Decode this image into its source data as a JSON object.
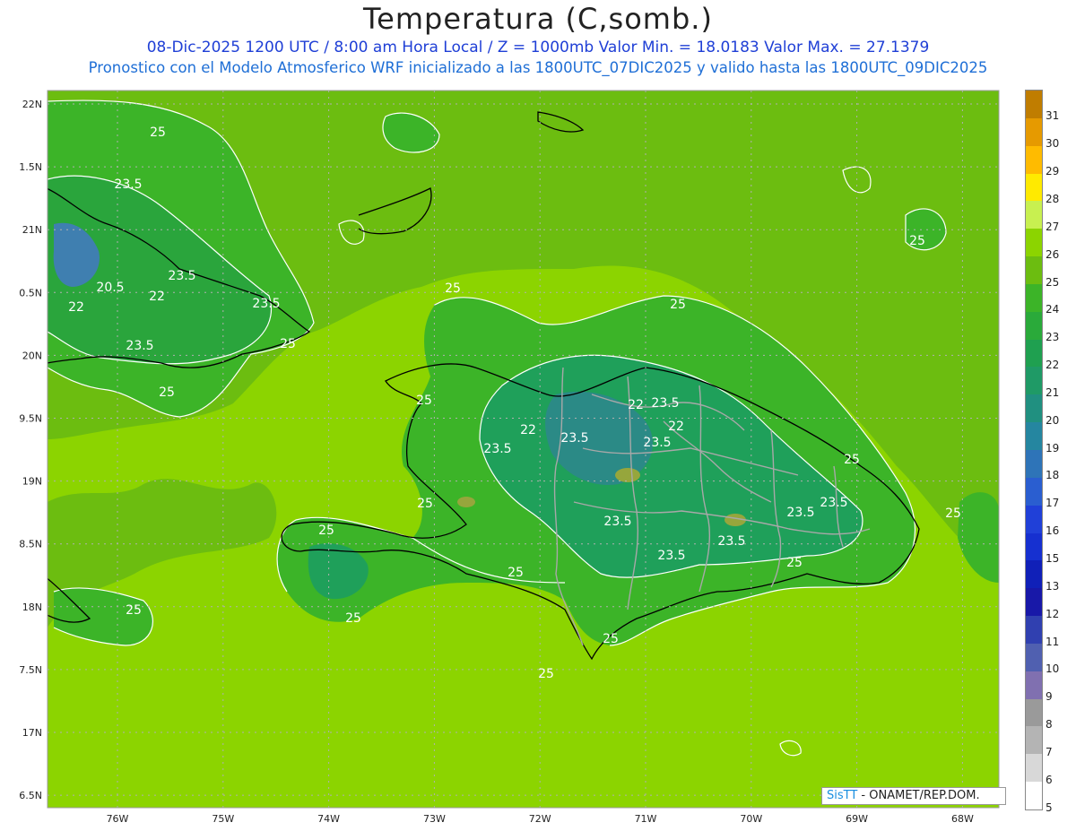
{
  "header": {
    "title": "Temperatura (C,somb.)",
    "subtitle1": "08-Dic-2025  1200 UTC / 8:00 am Hora Local / Z = 1000mb   Valor Min. = 18.0183  Valor Max. = 27.1379",
    "subtitle2": "Pronostico con el Modelo Atmosferico WRF inicializado a las 1800UTC_07DIC2025 y valido hasta las  1800UTC_09DIC2025"
  },
  "map": {
    "lat_labels": [
      "22N",
      "1.5N",
      "21N",
      "0.5N",
      "20N",
      "9.5N",
      "19N",
      "8.5N",
      "18N",
      "7.5N",
      "17N",
      "6.5N"
    ],
    "lon_labels": [
      "76W",
      "75W",
      "74W",
      "73W",
      "72W",
      "71W",
      "70W",
      "69W",
      "68W"
    ],
    "contour_labels": [
      "25",
      "23.5",
      "23.5",
      "20.5",
      "22",
      "22",
      "23.5",
      "23.5",
      "25",
      "25",
      "25",
      "25",
      "25",
      "22",
      "23.5",
      "22",
      "23.5",
      "23.5",
      "22",
      "23.5",
      "25",
      "25",
      "25",
      "23.5",
      "23.5",
      "23.5",
      "23.5",
      "23.5",
      "25",
      "25",
      "25",
      "25",
      "25",
      "25",
      "25"
    ],
    "colors": {
      "ocean_light": "#8cd400",
      "ocean_mid": "#6cbd10",
      "land_main": "#3cb428",
      "land_cool": "#2aa53c",
      "cool_22": "#1fa05a",
      "cool_20": "#2b8a86",
      "cold_18": "#3f7fb0",
      "warm_patch": "#96a63c",
      "coast": "#000000",
      "border": "#a8a8a8",
      "contour": "#ffffff",
      "grid": "#b0b0b0"
    }
  },
  "colorbar": {
    "labels": [
      "31",
      "30",
      "29",
      "28",
      "27",
      "26",
      "25",
      "24",
      "23",
      "22",
      "21",
      "20",
      "19",
      "18",
      "17",
      "16",
      "15",
      "13",
      "12",
      "11",
      "10",
      "9",
      "8",
      "7",
      "6",
      "5"
    ],
    "colors": [
      "#c07d00",
      "#e69a00",
      "#ffbb00",
      "#ffea00",
      "#c8f050",
      "#8cd400",
      "#6cbd10",
      "#3cb428",
      "#2aaa3a",
      "#1fa050",
      "#1f9a66",
      "#209080",
      "#2586a0",
      "#2e74b8",
      "#2a5ed0",
      "#2040d8",
      "#1630d0",
      "#1020b8",
      "#1818a8",
      "#3040b0",
      "#5060b0",
      "#8070b0",
      "#9a9a9a",
      "#b4b4b4",
      "#d8d8d8",
      "#ffffff"
    ]
  },
  "credit": {
    "brand": "SisTT",
    "text": " - ONAMET/REP.DOM."
  }
}
